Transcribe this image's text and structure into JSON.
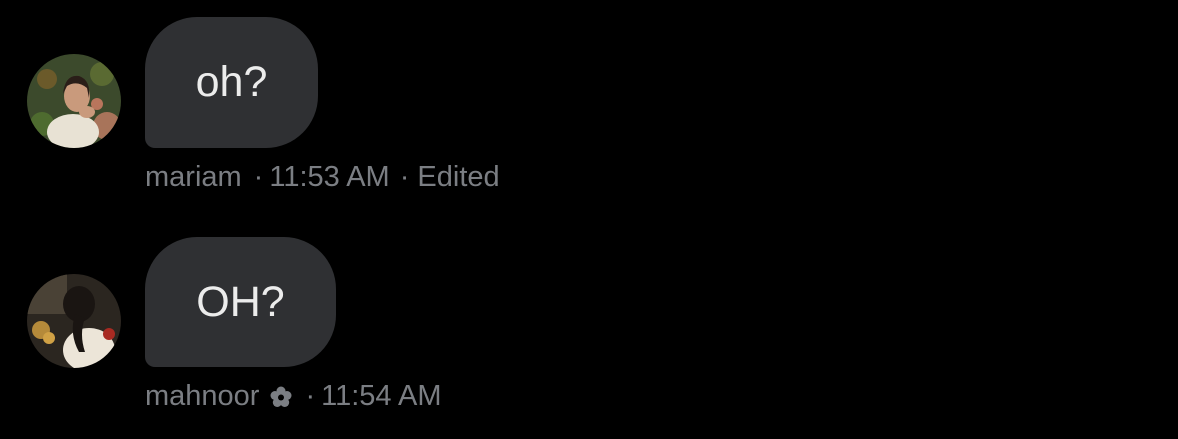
{
  "messages": [
    {
      "text": "oh?",
      "sender": "mariam",
      "separator": "·",
      "time": "11:53 AM",
      "status_separator": "·",
      "status": "Edited",
      "avatar_icon": "user-avatar-photo"
    },
    {
      "text": "OH?",
      "sender": "mahnoor",
      "sender_badge_icon": "flower-icon",
      "separator": "·",
      "time": "11:54 AM",
      "avatar_icon": "user-avatar-photo"
    }
  ],
  "colors": {
    "background": "#000000",
    "bubble": "#2f3033",
    "bubble_text": "#ececec",
    "meta_text": "#7b7e83"
  }
}
